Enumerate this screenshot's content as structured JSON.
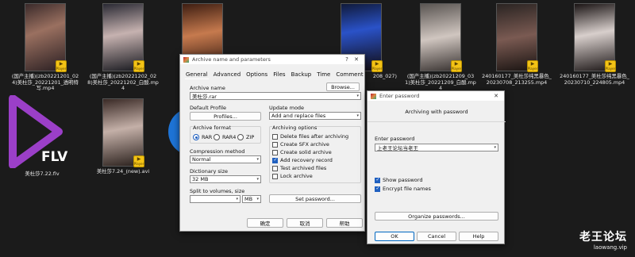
{
  "thumbnails_row1": [
    {
      "caption": "(国产主播)(zb20221201_024)美杜莎_20221201_透明特写.mp4"
    },
    {
      "caption": "(国产主播)(zb20221202_028)美杜莎_20221202_白酸.mp4"
    },
    {
      "caption": ""
    },
    {
      "caption": ""
    },
    {
      "caption": "208_027)"
    },
    {
      "caption": "(国产主播)(zb20221209_031)美杜莎_20221209_白酸.mp4"
    },
    {
      "caption": "240160177_美杜莎纯黑暴色_20230708_213255.mp4"
    },
    {
      "caption": "240160177_美杜莎纯黑暴色_20230710_224805.mp4"
    }
  ],
  "thumbnails_row2": [
    {
      "caption": "美杜莎7.22.flv",
      "type": "flv"
    },
    {
      "caption": "美杜莎7.24_(new).avi"
    }
  ],
  "badge_label": "Player",
  "flv_label": "FLV",
  "archive_dialog": {
    "title": "Archive name and parameters",
    "help_glyph": "?",
    "close_glyph": "✕",
    "tabs": [
      "General",
      "Advanced",
      "Options",
      "Files",
      "Backup",
      "Time",
      "Comment"
    ],
    "archive_name_label": "Archive name",
    "browse_label": "Browse...",
    "archive_name_value": "美杜莎.rar",
    "default_profile_label": "Default Profile",
    "profiles_label": "Profiles...",
    "update_mode_label": "Update mode",
    "update_mode_value": "Add and replace files",
    "archive_format_label": "Archive format",
    "formats": [
      "RAR",
      "RAR4",
      "ZIP"
    ],
    "archiving_options_label": "Archiving options",
    "options": [
      {
        "label": "Delete files after archiving",
        "checked": false
      },
      {
        "label": "Create SFX archive",
        "checked": false
      },
      {
        "label": "Create solid archive",
        "checked": false
      },
      {
        "label": "Add recovery record",
        "checked": true
      },
      {
        "label": "Test archived files",
        "checked": false
      },
      {
        "label": "Lock archive",
        "checked": false
      }
    ],
    "compression_method_label": "Compression method",
    "compression_method_value": "Normal",
    "dictionary_size_label": "Dictionary size",
    "dictionary_size_value": "32 MB",
    "split_label": "Split to volumes, size",
    "split_unit": "MB",
    "set_password_label": "Set password...",
    "ok_label": "确定",
    "cancel_label": "取消",
    "help_label": "帮助"
  },
  "password_dialog": {
    "title": "Enter password",
    "close_glyph": "✕",
    "subtitle": "Archiving with password",
    "enter_password_label": "Enter password",
    "password_value": "上老王论坛当老王",
    "show_password_label": "Show password",
    "encrypt_names_label": "Encrypt file names",
    "organize_label": "Organize passwords...",
    "ok_label": "OK",
    "cancel_label": "Cancel",
    "help_label": "Help"
  },
  "watermark": {
    "title": "老王论坛",
    "url": "laowang.vip"
  }
}
